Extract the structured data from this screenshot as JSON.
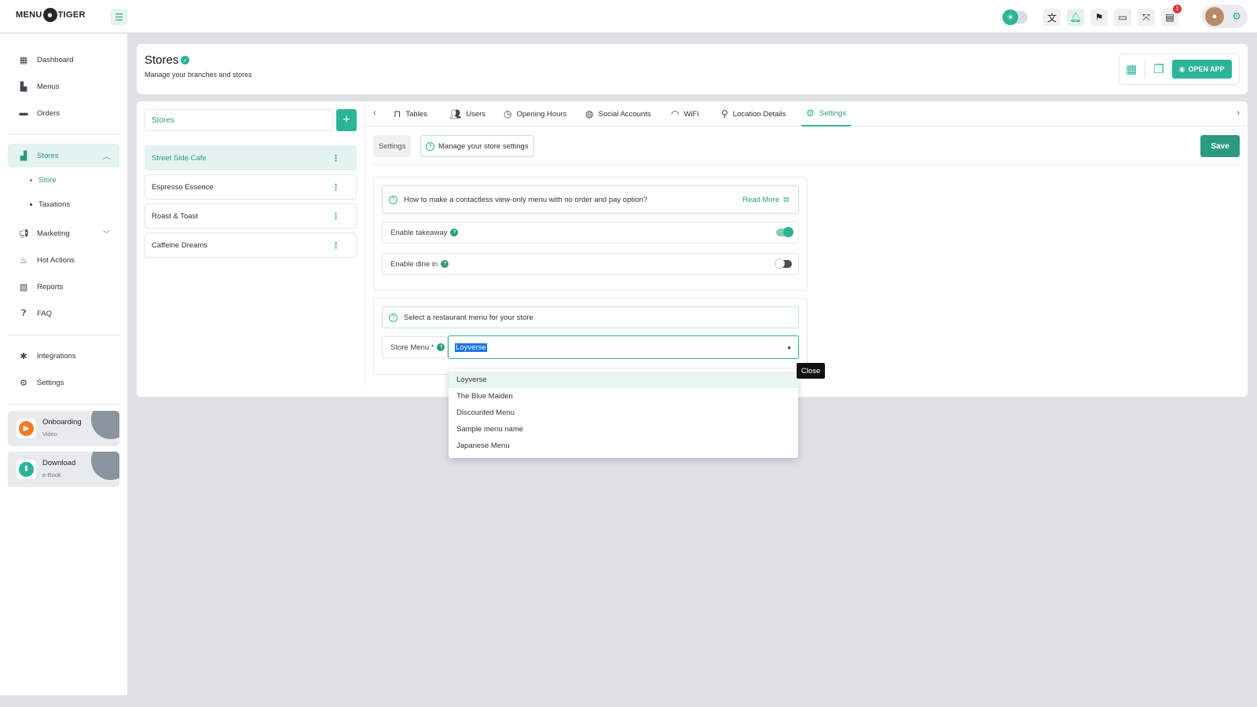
{
  "app": {
    "logo_left": "MENU",
    "logo_right": "TIGER"
  },
  "topbar": {
    "icons": [
      "theme-toggle-icon",
      "translate-icon",
      "bell-icon",
      "flag-icon",
      "devices-icon",
      "fullscreen-icon",
      "clipboard-icon"
    ],
    "notification_count": "1"
  },
  "sidebar": {
    "items": [
      {
        "label": "Dashboard",
        "icon": "dashboard-icon"
      },
      {
        "label": "Menus",
        "icon": "menus-icon"
      },
      {
        "label": "Orders",
        "icon": "orders-icon"
      },
      {
        "label": "Stores",
        "icon": "stores-icon"
      },
      {
        "label": "Marketing",
        "icon": "megaphone-icon"
      },
      {
        "label": "Hot Actions",
        "icon": "fire-icon"
      },
      {
        "label": "Reports",
        "icon": "reports-icon"
      },
      {
        "label": "FAQ",
        "icon": "faq-icon"
      },
      {
        "label": "Integrations",
        "icon": "puzzle-icon"
      },
      {
        "label": "Settings",
        "icon": "gear-icon"
      }
    ],
    "sub_items": [
      "Store",
      "Taxations"
    ],
    "promos": [
      {
        "title": "Onboarding",
        "subtitle": "Video",
        "color": "#f47b20"
      },
      {
        "title": "Download",
        "subtitle": "e-Book",
        "color": "#2bb497"
      }
    ]
  },
  "header": {
    "title": "Stores",
    "subtitle": "Manage your branches and stores",
    "open_app": "OPEN APP"
  },
  "stores": {
    "search_placeholder": "Stores",
    "items": [
      "Street Side Cafe",
      "Espresso Essence",
      "Roast & Toast",
      "Caffeine Dreams"
    ]
  },
  "tabs": [
    "Tables",
    "Users",
    "Opening Hours",
    "Social Accounts",
    "WiFi",
    "Location Details",
    "Settings"
  ],
  "settings": {
    "chip_label": "Settings",
    "help_chip": "Manage your store settings",
    "save": "Save",
    "info_text": "How to make a contactless view-only menu with no order and pay option?",
    "read_more": "Read More",
    "enable_takeaway": "Enable takeaway",
    "enable_dine_in": "Enable dine in",
    "takeaway_on": true,
    "dine_in_on": false,
    "menu_info": "Select a restaurant menu for your store",
    "store_menu_label": "Store Menu *",
    "store_menu_value": "Loyverse",
    "menu_options": [
      "Loyverse",
      "The Blue Maiden",
      "Discounted Menu",
      "Sample menu name",
      "Japanese Menu"
    ],
    "tooltip": "Close"
  },
  "colors": {
    "accent": "#2bb497",
    "accent_dark": "#2b9a80",
    "background": "#dde1e6"
  }
}
